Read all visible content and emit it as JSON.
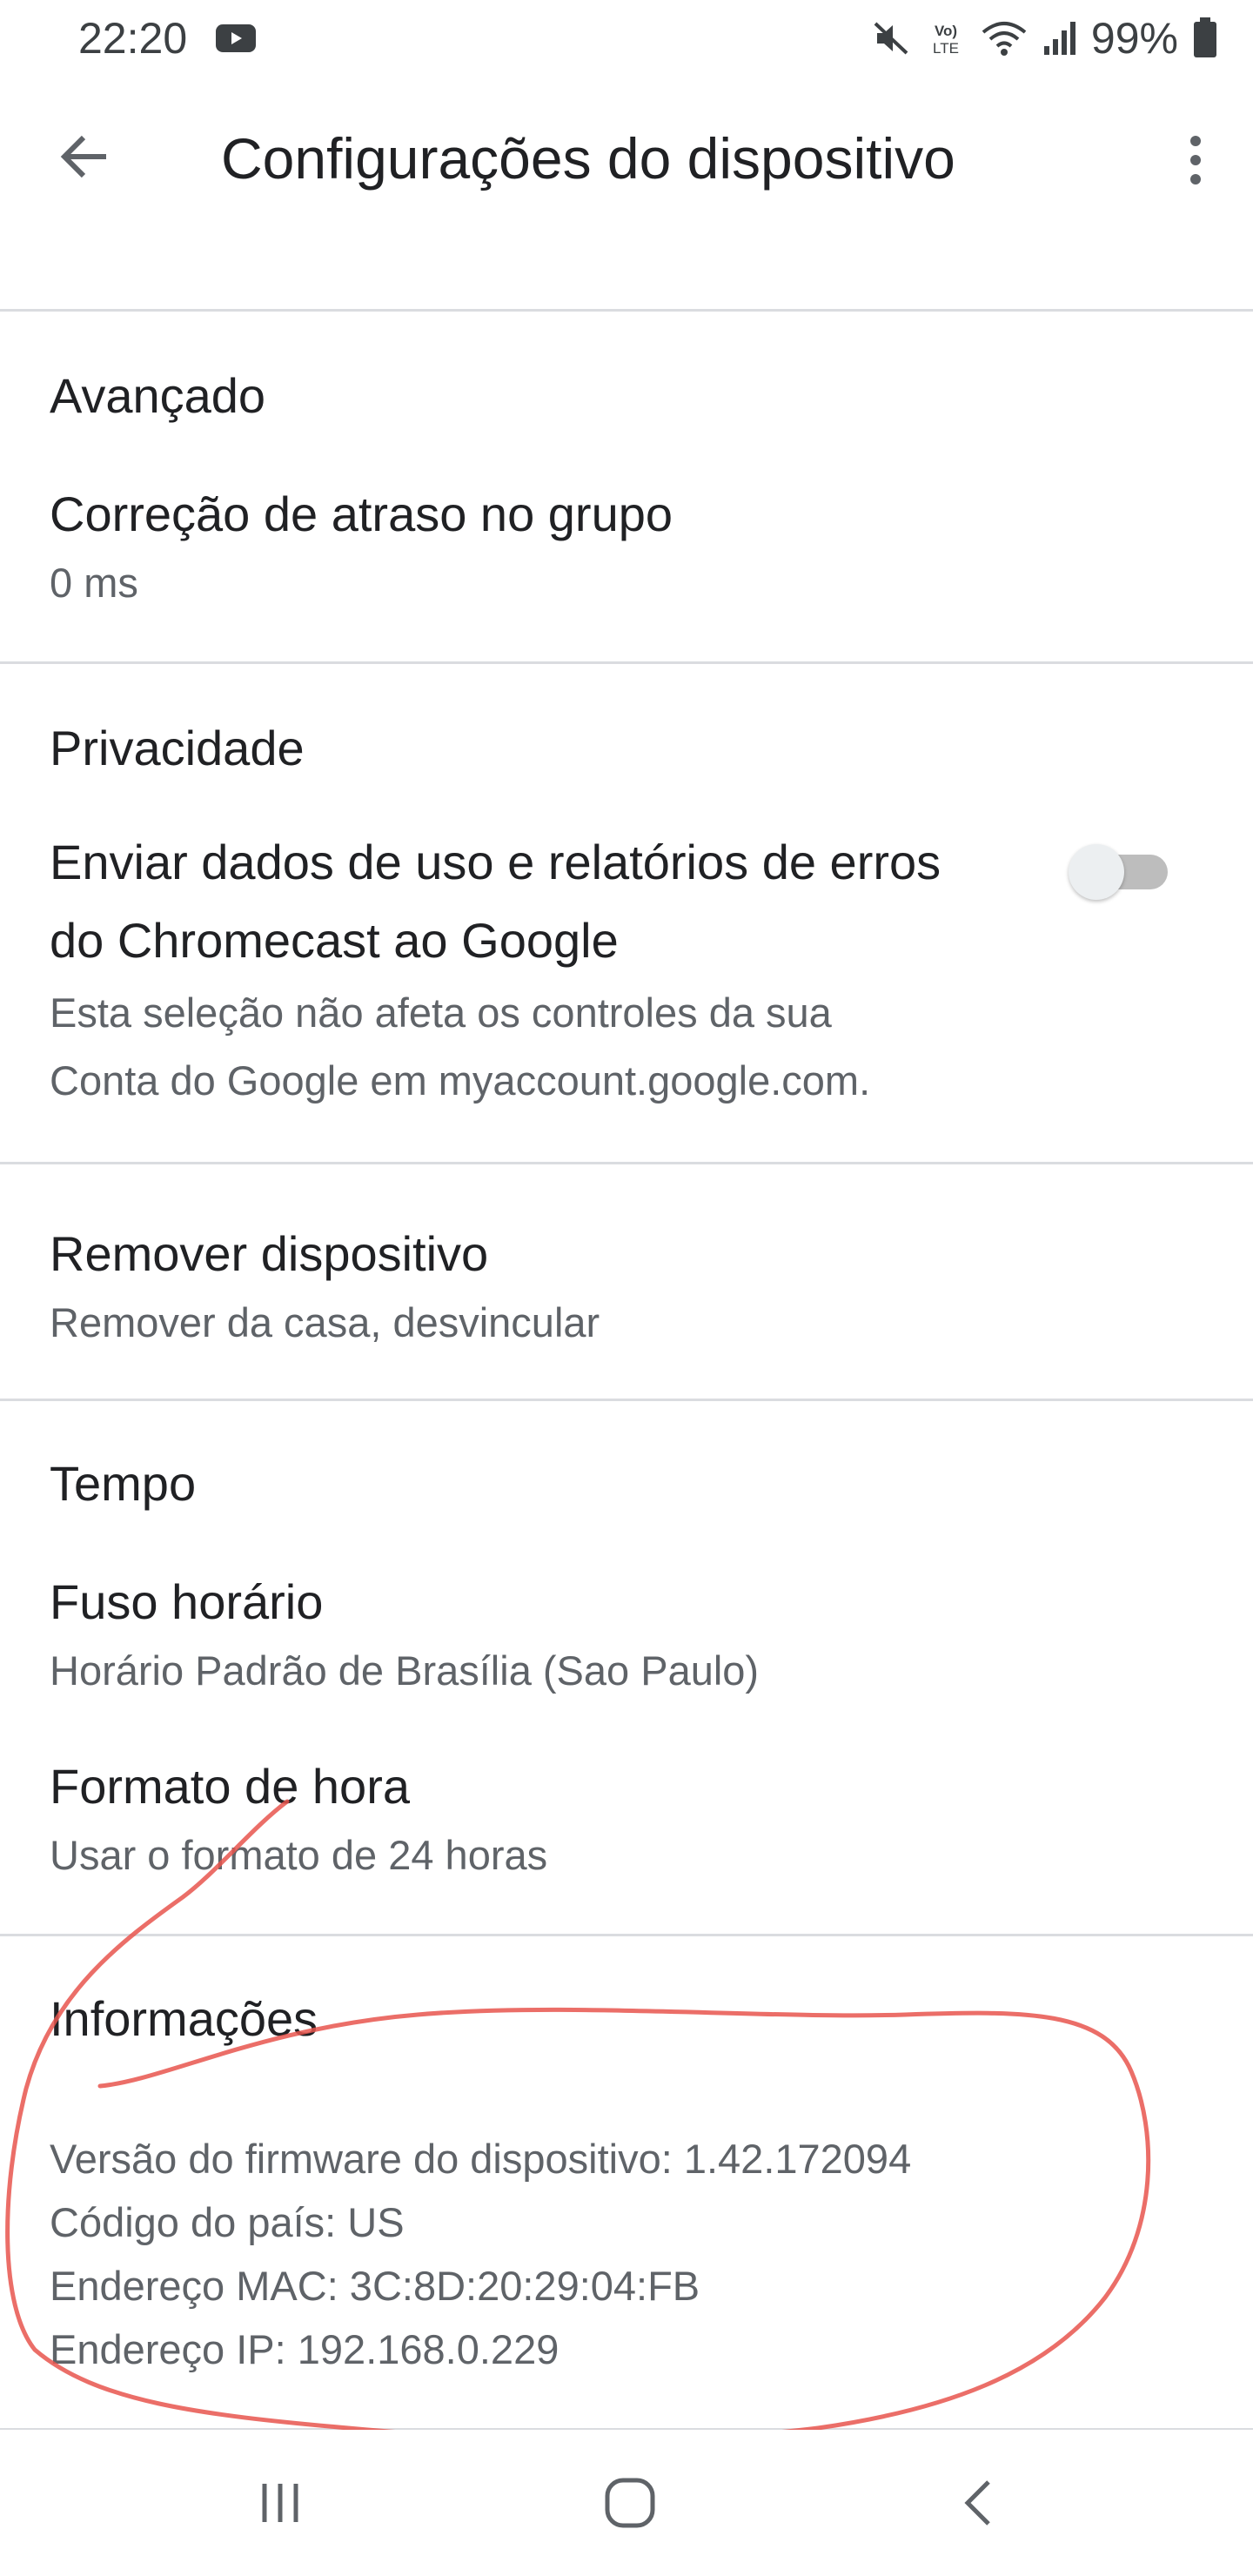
{
  "status_bar": {
    "time": "22:20",
    "battery": "99%",
    "icons": [
      "youtube-icon",
      "mute-icon",
      "volte-icon",
      "wifi-icon",
      "signal-icon",
      "battery-icon"
    ]
  },
  "app_bar": {
    "title": "Configurações do dispositivo",
    "back_icon": "arrow-back-icon",
    "menu_icon": "more-vert-icon"
  },
  "sections": {
    "advanced": {
      "header": "Avançado",
      "group_delay": {
        "title": "Correção de atraso no grupo",
        "value": "0 ms"
      }
    },
    "privacy": {
      "header": "Privacidade",
      "usage": {
        "title_line1": "Enviar dados de uso e relatórios de erros",
        "title_line2": "do Chromecast ao Google",
        "sub_line1": "Esta seleção não afeta os controles da sua",
        "sub_line2": "Conta do Google em myaccount.google.com.",
        "enabled": false
      }
    },
    "remove": {
      "title": "Remover dispositivo",
      "sub": "Remover da casa, desvincular"
    },
    "time": {
      "header": "Tempo",
      "timezone": {
        "title": "Fuso horário",
        "value": "Horário Padrão de Brasília (Sao Paulo)"
      },
      "format": {
        "title": "Formato de hora",
        "value": "Usar o formato de 24 horas"
      }
    },
    "info": {
      "header": "Informações",
      "firmware": "Versão do firmware do dispositivo: 1.42.172094",
      "country": "Código do país: US",
      "mac": "Endereço MAC: 3C:8D:20:29:04:FB",
      "ip": "Endereço IP: 192.168.0.229"
    }
  },
  "nav_bar": {
    "icons": [
      "recents-icon",
      "home-icon",
      "back-nav-icon"
    ]
  },
  "colors": {
    "text_primary": "#202124",
    "text_secondary": "#5f6368",
    "divider": "#dadce0",
    "annotation": "#e8554e"
  }
}
